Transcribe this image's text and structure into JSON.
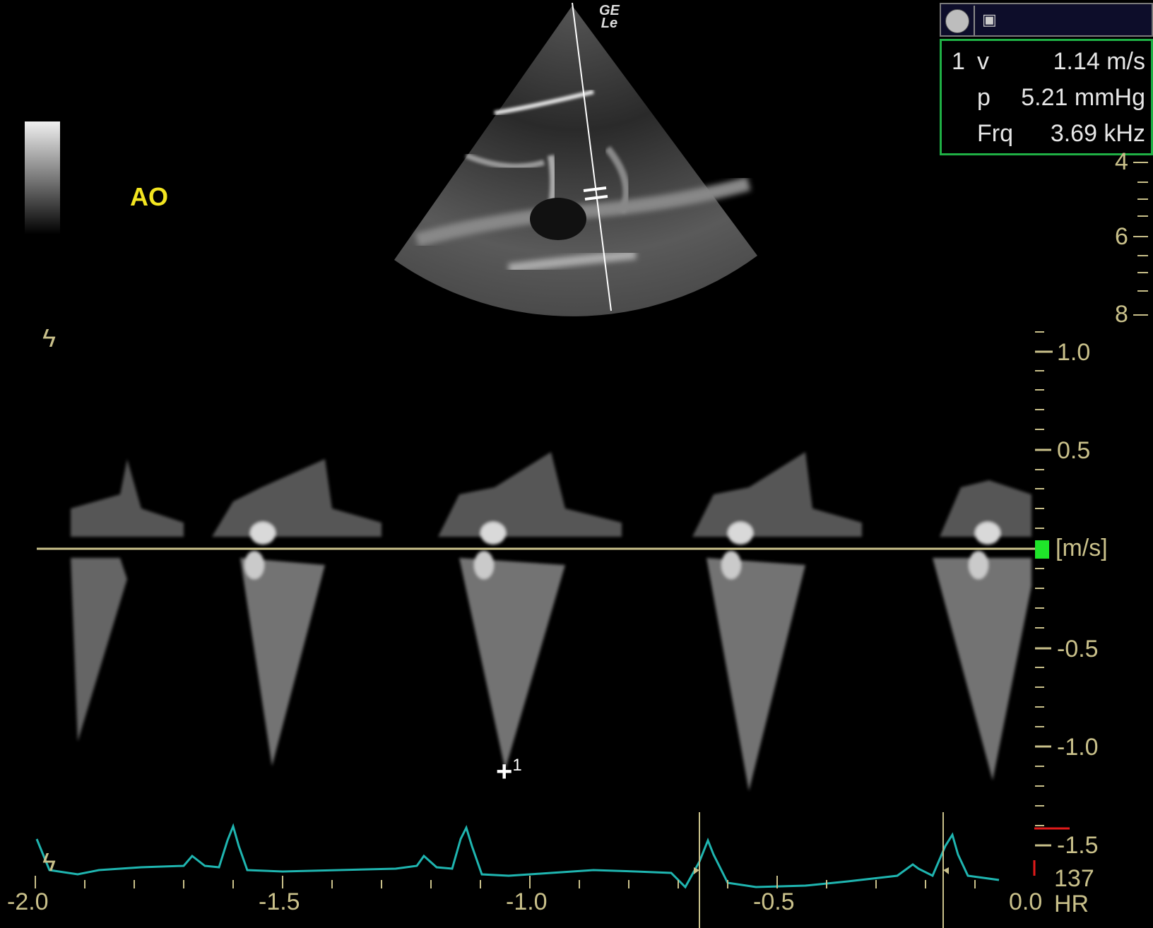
{
  "window": {
    "vendor_logo": "GE",
    "vendor_logo_sub": "Le",
    "view_label": "AO"
  },
  "toolbar": {
    "record_icon": "circle-record-icon",
    "image_icon": "image-cursor-icon",
    "image_glyph": "▣"
  },
  "measurement": {
    "index": "1",
    "rows": [
      {
        "name": "v",
        "value": "1.14 m/s"
      },
      {
        "name": "p",
        "value": "5.21 mmHg"
      },
      {
        "name": "Frq",
        "value": "3.69 kHz"
      }
    ],
    "cursor_label": "1",
    "cursor_glyph": "+"
  },
  "depth_scale": {
    "labels": [
      "4",
      "6",
      "8"
    ]
  },
  "velocity_scale": {
    "labels": [
      "1.0",
      "0.5",
      "-0.5",
      "-1.0",
      "-1.5"
    ],
    "unit": "[m/s]"
  },
  "time_axis": {
    "labels": [
      "-2.0",
      "-1.5",
      "-1.0",
      "-0.5",
      "0.0"
    ]
  },
  "heart_rate": {
    "value": "137",
    "label": "HR"
  },
  "colors": {
    "ecg": "#1fb5b0",
    "baseline": "#c9c08a",
    "accent_green": "#1fe52a",
    "ao_label": "#f3e520"
  }
}
